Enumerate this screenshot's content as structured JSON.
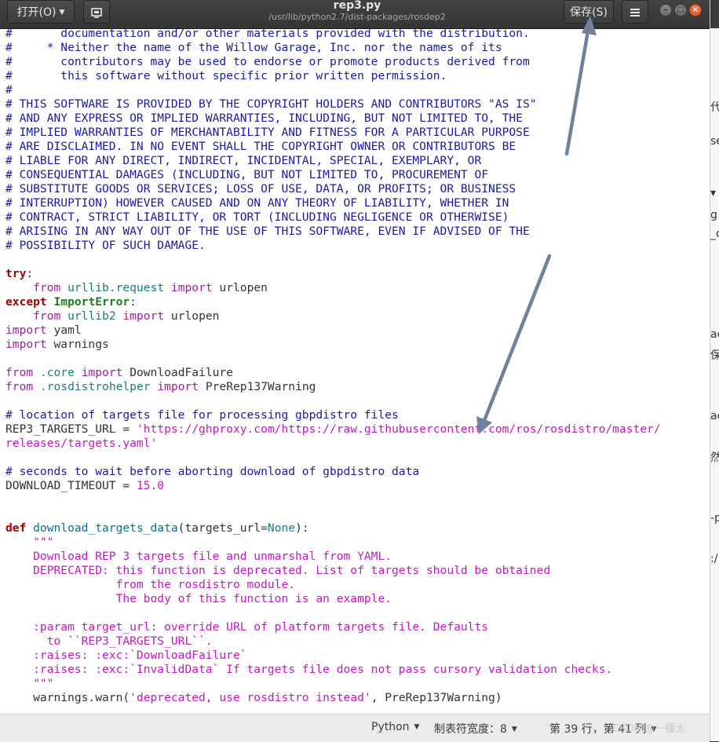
{
  "window": {
    "title": "rep3.py",
    "path": "/usr/lib/python2.7/dist-packages/rosdep2"
  },
  "header": {
    "open_label": "打开(O)",
    "save_label": "保存(S)",
    "minimize": "–",
    "maximize": "□",
    "close": "×"
  },
  "icons": [
    "chevron-down-icon",
    "pin-icon",
    "hamburger-menu-icon",
    "minimize-icon",
    "maximize-icon",
    "close-icon"
  ],
  "colors": {
    "comment": "#1a1aa6",
    "keyword": "#a40000",
    "import_keyword": "#a020a0",
    "string": "#c417c4",
    "close_button": "#e05a2a",
    "annotation_arrow": "#6f8299"
  },
  "code_lines": [
    [
      {
        "t": "#       documentation and/or other materials provided with the distribution.",
        "c": "c"
      }
    ],
    [
      {
        "t": "#     * Neither the name of the Willow Garage, Inc. nor the names of its",
        "c": "c"
      }
    ],
    [
      {
        "t": "#       contributors may be used to endorse or promote products derived from",
        "c": "c"
      }
    ],
    [
      {
        "t": "#       this software without specific prior written permission.",
        "c": "c"
      }
    ],
    [
      {
        "t": "#",
        "c": "c"
      }
    ],
    [
      {
        "t": "# THIS SOFTWARE IS PROVIDED BY THE COPYRIGHT HOLDERS AND CONTRIBUTORS \"AS IS\"",
        "c": "c"
      }
    ],
    [
      {
        "t": "# AND ANY EXPRESS OR IMPLIED WARRANTIES, INCLUDING, BUT NOT LIMITED TO, THE",
        "c": "c"
      }
    ],
    [
      {
        "t": "# IMPLIED WARRANTIES OF MERCHANTABILITY AND FITNESS FOR A PARTICULAR PURPOSE",
        "c": "c"
      }
    ],
    [
      {
        "t": "# ARE DISCLAIMED. IN NO EVENT SHALL THE COPYRIGHT OWNER OR CONTRIBUTORS BE",
        "c": "c"
      }
    ],
    [
      {
        "t": "# LIABLE FOR ANY DIRECT, INDIRECT, INCIDENTAL, SPECIAL, EXEMPLARY, OR",
        "c": "c"
      }
    ],
    [
      {
        "t": "# CONSEQUENTIAL DAMAGES (INCLUDING, BUT NOT LIMITED TO, PROCUREMENT OF",
        "c": "c"
      }
    ],
    [
      {
        "t": "# SUBSTITUTE GOODS OR SERVICES; LOSS OF USE, DATA, OR PROFITS; OR BUSINESS",
        "c": "c"
      }
    ],
    [
      {
        "t": "# INTERRUPTION) HOWEVER CAUSED AND ON ANY THEORY OF LIABILITY, WHETHER IN",
        "c": "c"
      }
    ],
    [
      {
        "t": "# CONTRACT, STRICT LIABILITY, OR TORT (INCLUDING NEGLIGENCE OR OTHERWISE)",
        "c": "c"
      }
    ],
    [
      {
        "t": "# ARISING IN ANY WAY OUT OF THE USE OF THIS SOFTWARE, EVEN IF ADVISED OF THE",
        "c": "c"
      }
    ],
    [
      {
        "t": "# POSSIBILITY OF SUCH DAMAGE.",
        "c": "c"
      }
    ],
    [],
    [
      {
        "t": "try",
        "c": "k"
      },
      {
        "t": ":"
      }
    ],
    [
      {
        "t": "    "
      },
      {
        "t": "from",
        "c": "kw"
      },
      {
        "t": " "
      },
      {
        "t": "urllib.request",
        "c": "m"
      },
      {
        "t": " "
      },
      {
        "t": "import",
        "c": "kw"
      },
      {
        "t": " urlopen"
      }
    ],
    [
      {
        "t": "except",
        "c": "k"
      },
      {
        "t": " "
      },
      {
        "t": "ImportError",
        "c": "ex"
      },
      {
        "t": ":"
      }
    ],
    [
      {
        "t": "    "
      },
      {
        "t": "from",
        "c": "kw"
      },
      {
        "t": " "
      },
      {
        "t": "urllib2",
        "c": "m"
      },
      {
        "t": " "
      },
      {
        "t": "import",
        "c": "kw"
      },
      {
        "t": " urlopen"
      }
    ],
    [
      {
        "t": "import",
        "c": "kw"
      },
      {
        "t": " yaml"
      }
    ],
    [
      {
        "t": "import",
        "c": "kw"
      },
      {
        "t": " warnings"
      }
    ],
    [],
    [
      {
        "t": "from",
        "c": "kw"
      },
      {
        "t": " "
      },
      {
        "t": ".core",
        "c": "m"
      },
      {
        "t": " "
      },
      {
        "t": "import",
        "c": "kw"
      },
      {
        "t": " DownloadFailure"
      }
    ],
    [
      {
        "t": "from",
        "c": "kw"
      },
      {
        "t": " "
      },
      {
        "t": ".rosdistrohelper",
        "c": "m"
      },
      {
        "t": " "
      },
      {
        "t": "import",
        "c": "kw"
      },
      {
        "t": " PreRep137Warning"
      }
    ],
    [],
    [
      {
        "t": "# location of targets file for processing gbpdistro files",
        "c": "c"
      }
    ],
    [
      {
        "t": "REP3_TARGETS_URL = "
      },
      {
        "t": "'https://ghproxy.com/https://raw.githubusercontent.com/ros/rosdistro/master/",
        "c": "s"
      }
    ],
    [
      {
        "t": "releases/targets.yaml'",
        "c": "s"
      }
    ],
    [],
    [
      {
        "t": "# seconds to wait before aborting download of gbpdistro data",
        "c": "c"
      }
    ],
    [
      {
        "t": "DOWNLOAD_TIMEOUT = "
      },
      {
        "t": "15.0",
        "c": "n"
      }
    ],
    [],
    [],
    [
      {
        "t": "def",
        "c": "k"
      },
      {
        "t": " "
      },
      {
        "t": "download_targets_data",
        "c": "fn"
      },
      {
        "t": "(targets_url="
      },
      {
        "t": "None",
        "c": "m"
      },
      {
        "t": "):"
      }
    ],
    [
      {
        "t": "    "
      },
      {
        "t": "\"\"\"",
        "c": "s"
      }
    ],
    [
      {
        "t": "    Download REP 3 targets file and unmarshal from YAML.",
        "c": "s"
      }
    ],
    [
      {
        "t": "    DEPRECATED: this function is deprecated. List of targets should be obtained",
        "c": "s"
      }
    ],
    [
      {
        "t": "                from the rosdistro module.",
        "c": "s"
      }
    ],
    [
      {
        "t": "                The body of this function is an example.",
        "c": "s"
      }
    ],
    [],
    [
      {
        "t": "    :param target_url: override URL of platform targets file. Defaults",
        "c": "s"
      }
    ],
    [
      {
        "t": "      to ``REP3_TARGETS_URL``.",
        "c": "s"
      }
    ],
    [
      {
        "t": "    :raises: :exc:`DownloadFailure`",
        "c": "s"
      }
    ],
    [
      {
        "t": "    :raises: :exc:`InvalidData` If targets file does not pass cursory validation checks.",
        "c": "s"
      }
    ],
    [
      {
        "t": "    \"\"\"",
        "c": "s"
      }
    ],
    [
      {
        "t": "    warnings.warn("
      },
      {
        "t": "'deprecated, use rosdistro instead'",
        "c": "s"
      },
      {
        "t": ", PreRep137Warning)"
      }
    ]
  ],
  "statusbar": {
    "language": "Python",
    "tab_width": "制表符宽度：8",
    "position": "第 39 行，第 41 列"
  },
  "watermark": "CSDN @一播太",
  "right_window_fragments": [
    "代",
    "se",
    "▾",
    "g",
    "_c",
    "ac",
    "保存",
    "ac",
    "然",
    "-p",
    ":/"
  ]
}
